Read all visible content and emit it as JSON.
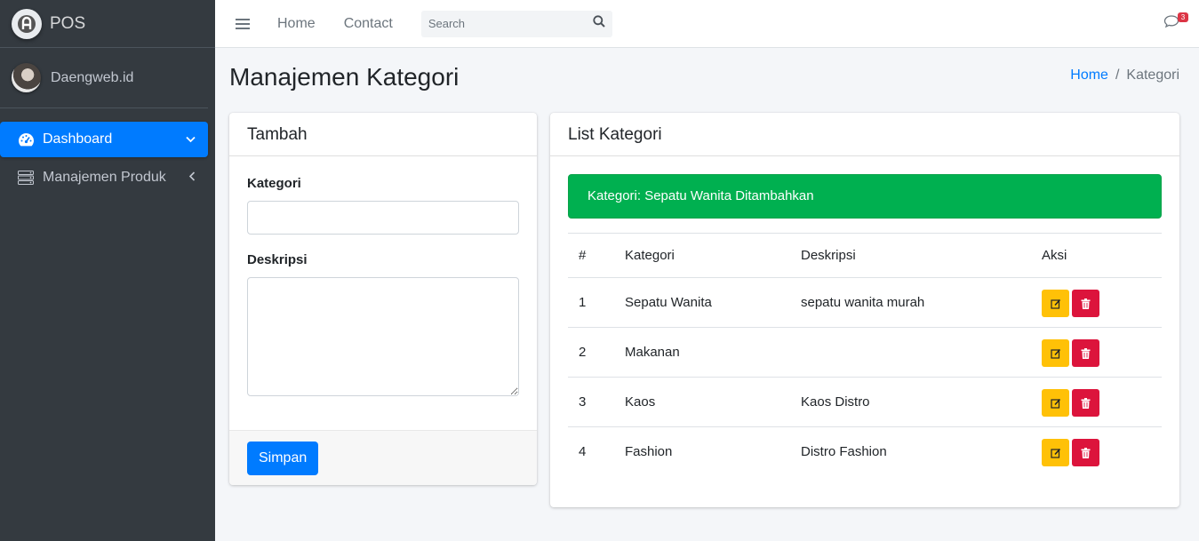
{
  "brand": {
    "name": "POS"
  },
  "user": {
    "name": "Daengweb.id"
  },
  "sidebar": {
    "items": [
      {
        "label": "Dashboard",
        "icon": "tachometer-icon",
        "arrow": "chevron-down-icon",
        "active": true
      },
      {
        "label": "Manajemen Produk",
        "icon": "server-icon",
        "arrow": "chevron-left-icon",
        "active": false
      }
    ]
  },
  "topnav": {
    "links": [
      "Home",
      "Contact"
    ],
    "search_placeholder": "Search",
    "messages_count": "3"
  },
  "page": {
    "title": "Manajemen Kategori",
    "breadcrumb": {
      "home": "Home",
      "separator": "/",
      "current": "Kategori"
    }
  },
  "add_card": {
    "title": "Tambah",
    "kategori_label": "Kategori",
    "kategori_value": "",
    "deskripsi_label": "Deskripsi",
    "deskripsi_value": "",
    "submit_label": "Simpan"
  },
  "list_card": {
    "title": "List Kategori",
    "alert": "Kategori: Sepatu Wanita Ditambahkan",
    "columns": [
      "#",
      "Kategori",
      "Deskripsi",
      "Aksi"
    ],
    "rows": [
      {
        "no": "1",
        "kategori": "Sepatu Wanita",
        "deskripsi": "sepatu wanita murah"
      },
      {
        "no": "2",
        "kategori": "Makanan",
        "deskripsi": ""
      },
      {
        "no": "3",
        "kategori": "Kaos",
        "deskripsi": "Kaos Distro"
      },
      {
        "no": "4",
        "kategori": "Fashion",
        "deskripsi": "Distro Fashion"
      }
    ]
  },
  "colors": {
    "sidebar_bg": "#343a40",
    "primary": "#007bff",
    "success_alert": "#00b050",
    "edit_button": "#ffc107",
    "delete_button": "#dc143c",
    "badge": "#dc3545"
  }
}
